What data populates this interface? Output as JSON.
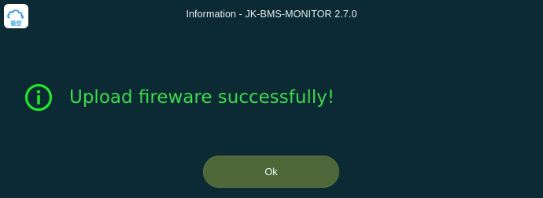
{
  "window": {
    "title": "Information - JK-BMS-MONITOR 2.7.0",
    "app_icon_text": "极空",
    "app_icon": "cloud-logo-icon"
  },
  "dialog": {
    "icon": "info-circle-icon",
    "message": "Upload fireware successfully!",
    "ok_label": "Ok"
  },
  "colors": {
    "background": "#0b2a33",
    "message_text": "#3fd94d",
    "info_icon": "#22e62c",
    "ok_button": "#4e6638",
    "title_text": "#e6ecee"
  }
}
